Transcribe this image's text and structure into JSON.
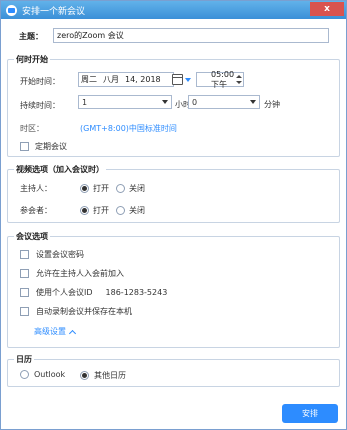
{
  "window": {
    "title": "安排一个新会议",
    "close_glyph": "x"
  },
  "topic": {
    "label": "主题：",
    "value": "zero的Zoom 会议"
  },
  "when": {
    "section_title": "何时开始",
    "start_label": "开始时间：",
    "date_weekday": "周二",
    "date_month": "八月",
    "date_day": "14, 2018",
    "time_value": "05:00 下午",
    "duration_label": "持续时间：",
    "duration_hours": "1",
    "hours_unit": "小时",
    "duration_minutes": "0",
    "minutes_unit": "分钟",
    "timezone_label": "时区：",
    "timezone_value": "(GMT+8:00)中国标准时间",
    "recurring_label": "定期会议"
  },
  "video": {
    "section_title": "视频选项（加入会议时）",
    "host_label": "主持人：",
    "participants_label": "参会者：",
    "on_label": "打开",
    "off_label": "关闭",
    "host_on": true,
    "participants_on": true
  },
  "options": {
    "section_title": "会议选项",
    "items": [
      {
        "label": "设置会议密码",
        "extra": ""
      },
      {
        "label": "允许在主持人入会前加入",
        "extra": ""
      },
      {
        "label": "使用个人会议ID",
        "extra": "186-1283-5243"
      },
      {
        "label": "自动录制会议并保存在本机",
        "extra": ""
      }
    ],
    "advanced_label": "高级设置"
  },
  "calendar": {
    "section_title": "日历",
    "outlook_label": "Outlook",
    "other_label": "其他日历",
    "selected": "other"
  },
  "actions": {
    "schedule_label": "安排"
  },
  "colors": {
    "accent": "#2d8cff",
    "titlebar": "#4a9de0",
    "close": "#d9534f"
  }
}
